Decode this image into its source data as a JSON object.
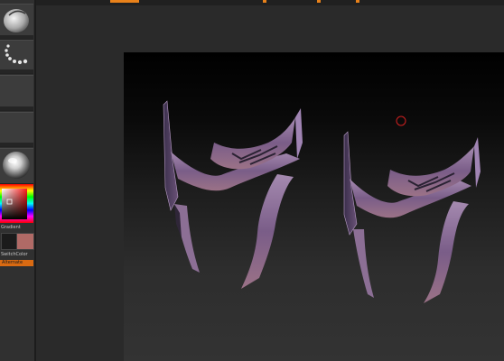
{
  "left_tray": {
    "slots": [
      {
        "name": "brush-slot",
        "caption": "",
        "icon": "clay-brush-icon"
      },
      {
        "name": "stroke-slot",
        "caption": "",
        "icon": "dots-stroke-icon"
      },
      {
        "name": "alpha-slot",
        "caption": "",
        "icon": "alpha-blank"
      },
      {
        "name": "texture-slot",
        "caption": "",
        "icon": "texture-blank"
      },
      {
        "name": "material-slot",
        "caption": "",
        "icon": "matcap-sphere-icon"
      }
    ],
    "gradient_label": "Gradient",
    "switch_color_label": "SwitchColor",
    "alternate_label": "Alternate"
  },
  "colors": {
    "accent": "#e8811a",
    "secondary_swatch": "#b06a66",
    "model_tint": "#8a6a8c"
  },
  "viewport": {
    "cursor_icon": "brush-cursor-icon"
  }
}
